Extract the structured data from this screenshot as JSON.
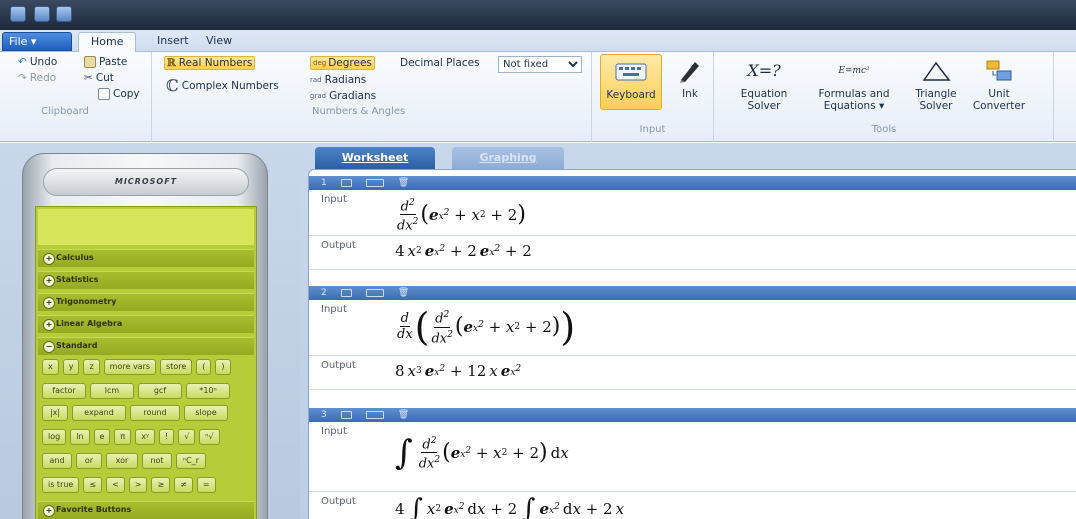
{
  "menu": {
    "file_label": "File",
    "tabs": [
      "Home",
      "Insert",
      "View"
    ]
  },
  "ribbon": {
    "clipboard": {
      "undo": "Undo",
      "redo": "Redo",
      "paste": "Paste",
      "cut": "Cut",
      "copy": "Copy",
      "group_label": "Clipboard"
    },
    "numbers": {
      "real": "Real Numbers",
      "complex": "Complex Numbers"
    },
    "angles": {
      "degrees": "Degrees",
      "radians": "Radians",
      "gradians": "Gradians",
      "decimal_label": "Decimal Places",
      "decimal_value": "Not fixed",
      "group_label": "Numbers & Angles"
    },
    "input": {
      "keyboard": "Keyboard",
      "ink": "Ink",
      "group_label": "Input"
    },
    "tools": {
      "eq_icon": "X=?",
      "eq_line1": "Equation",
      "eq_line2": "Solver",
      "form_icon": "E=mc²",
      "form_line1": "Formulas and",
      "form_line2": "Equations ▾",
      "tri_line1": "Triangle",
      "tri_line2": "Solver",
      "unit_line1": "Unit",
      "unit_line2": "Converter",
      "group_label": "Tools"
    }
  },
  "calculator": {
    "brand": "MICROSOFT",
    "sections": [
      {
        "label": "Calculus",
        "sym": "+"
      },
      {
        "label": "Statistics",
        "sym": "+"
      },
      {
        "label": "Trigonometry",
        "sym": "+"
      },
      {
        "label": "Linear Algebra",
        "sym": "+"
      },
      {
        "label": "Standard",
        "sym": "−"
      }
    ],
    "keys": [
      [
        "x",
        "y",
        "z",
        "more vars",
        "store",
        "(",
        ")"
      ],
      [
        "factor",
        "lcm",
        "gcf",
        "*10ⁿ"
      ],
      [
        "|x|",
        "expand",
        "round",
        "slope"
      ],
      [
        "log",
        "ln",
        "e",
        "π",
        "xʸ",
        "!",
        "√",
        "ⁿ√"
      ],
      [
        "and",
        "or",
        "xor",
        "not",
        "ⁿC_r"
      ],
      [
        "is true",
        "≤",
        "<",
        ">",
        "≥",
        "≠",
        "="
      ]
    ],
    "next_section": "Favorite Buttons"
  },
  "worksheet_tabs": {
    "worksheet": "Worksheet",
    "graphing": "Graphing"
  },
  "entries": [
    {
      "num": "1",
      "input_label": "Input",
      "output_label": "Output"
    },
    {
      "num": "2",
      "input_label": "Input",
      "output_label": "Output"
    },
    {
      "num": "3",
      "input_label": "Input",
      "output_label": "Output"
    }
  ]
}
